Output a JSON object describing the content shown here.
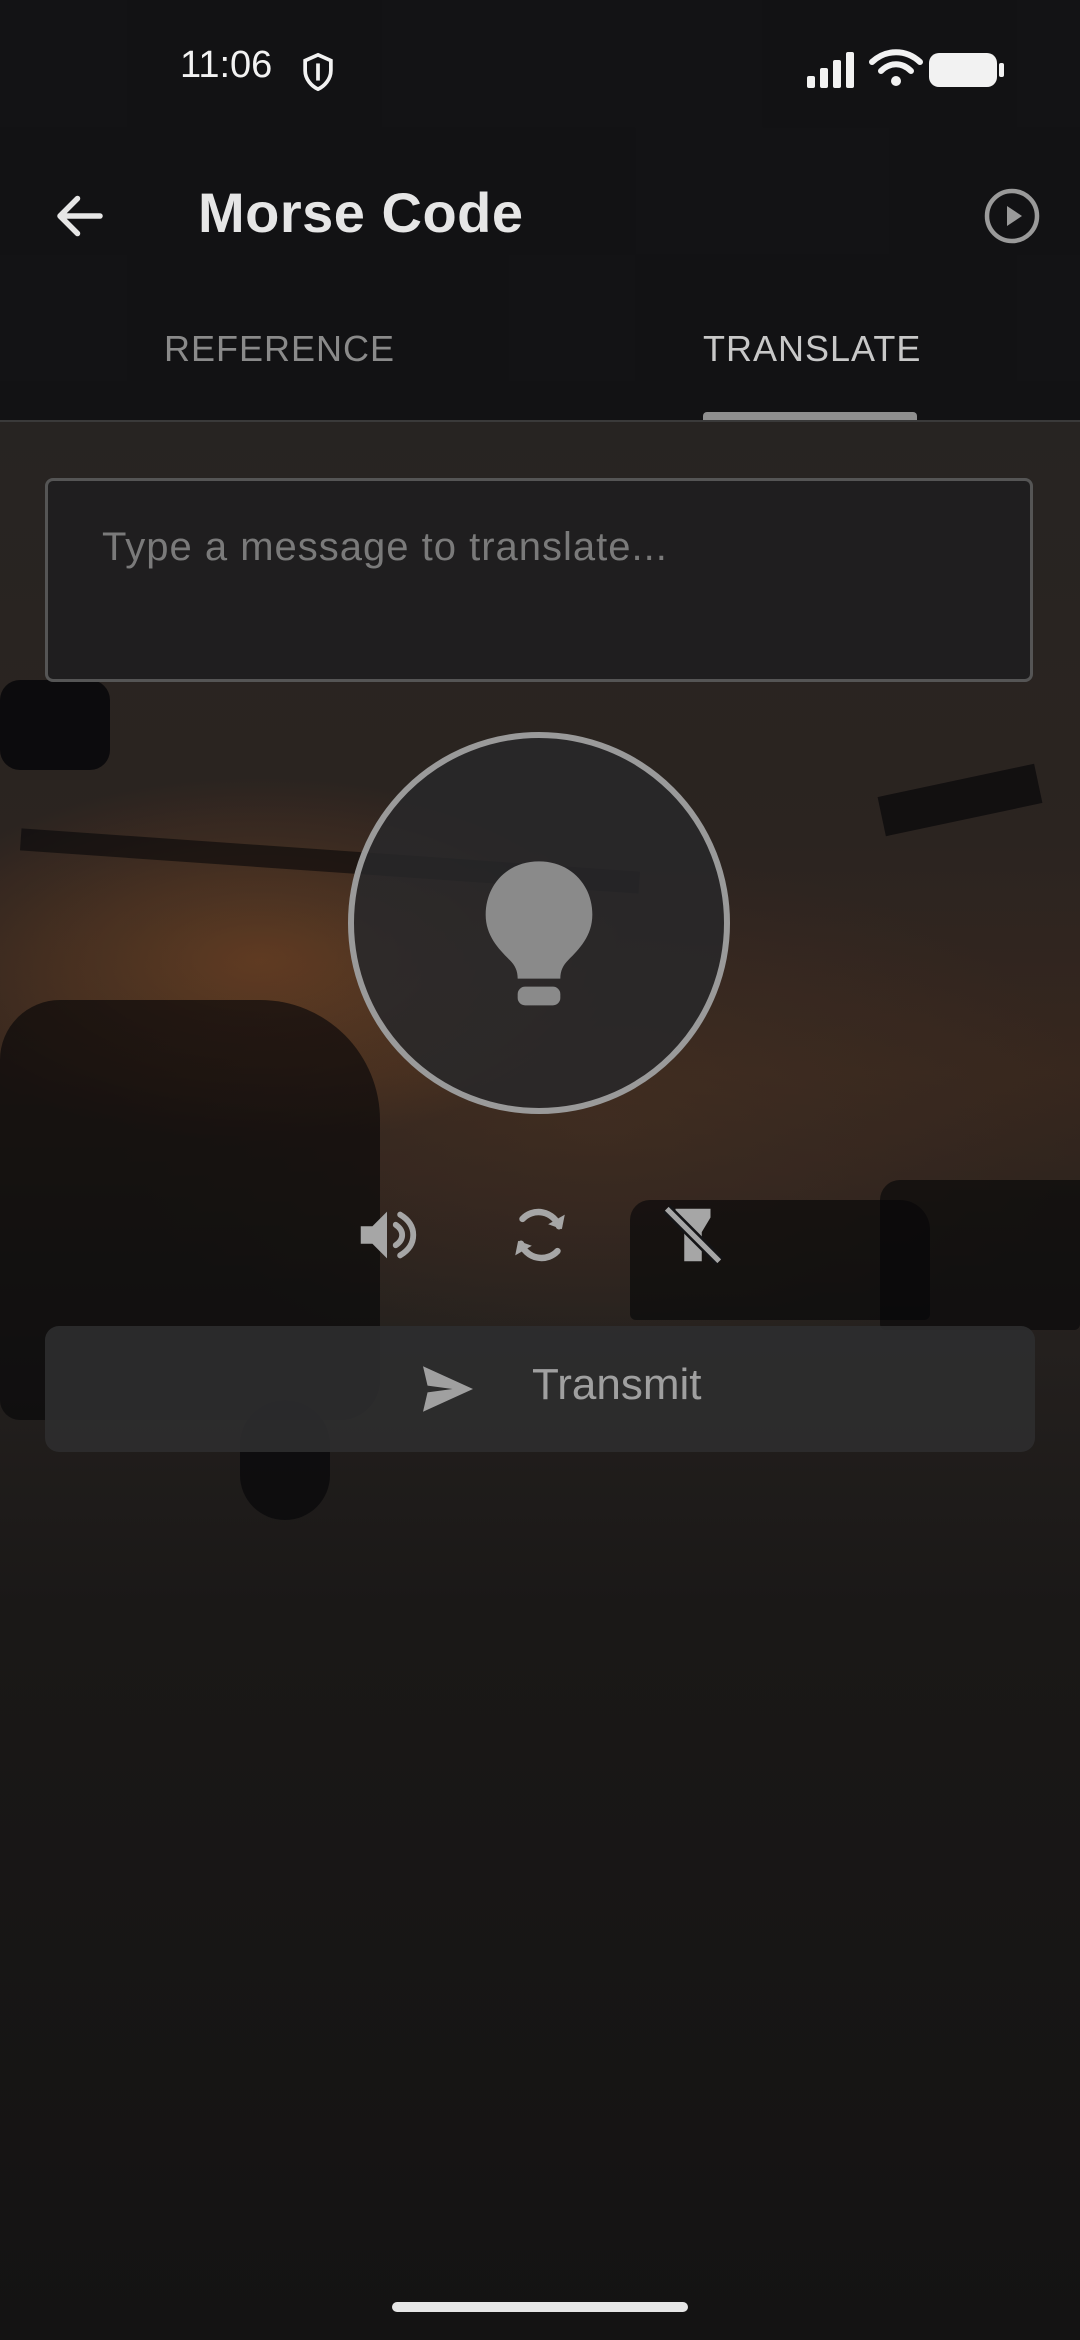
{
  "status_bar": {
    "time": "11:06",
    "icons": [
      "shield-icon",
      "signal-icon",
      "wifi-icon",
      "battery-icon"
    ]
  },
  "app_bar": {
    "title": "Morse Code",
    "back_icon": "arrow-left-icon",
    "action_icon": "play-circle-icon"
  },
  "tabs": [
    {
      "label": "REFERENCE",
      "selected": false
    },
    {
      "label": "TRANSLATE",
      "selected": true
    }
  ],
  "translate": {
    "input": {
      "value": "",
      "placeholder": "Type a message to translate..."
    },
    "light_icon": "lightbulb-icon",
    "controls": [
      "volume-icon",
      "repeat-icon",
      "flashlight-off-icon"
    ],
    "transmit_label": "Transmit",
    "transmit_icon": "send-icon"
  },
  "colors": {
    "background": "#141416",
    "text_primary": "#e6e6e6",
    "text_secondary": "#8a8a8a",
    "accent_outline": "#9a9a9a"
  }
}
